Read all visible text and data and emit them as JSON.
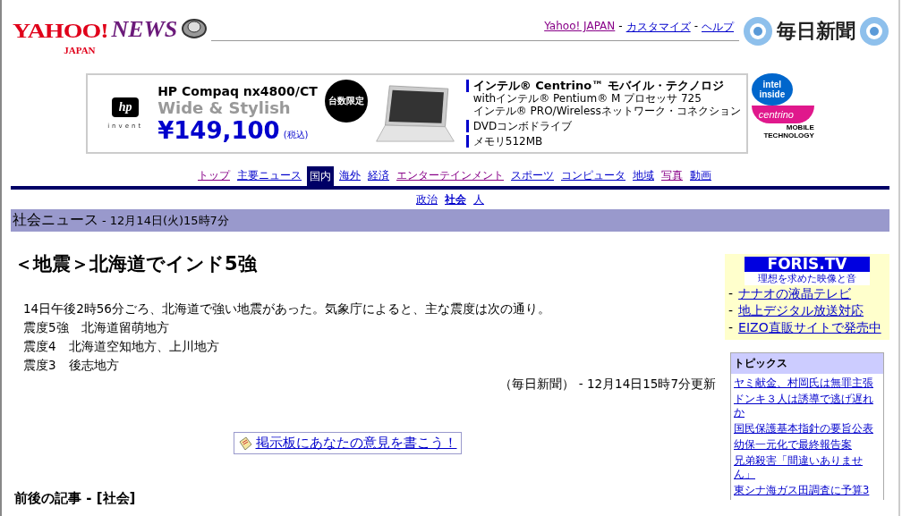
{
  "header": {
    "logo": {
      "main": "YAHOO!",
      "sub": "JAPAN",
      "news": "NEWS"
    },
    "links": [
      {
        "label": "Yahoo! JAPAN",
        "visited": true
      },
      {
        "label": "カスタマイズ",
        "visited": false
      },
      {
        "label": "ヘルプ",
        "visited": false
      }
    ],
    "separator": "-",
    "partner": "毎日新聞"
  },
  "ad": {
    "hp_logo": "hp",
    "hp_tagline": "invent",
    "title": "HP Compaq nx4800/CT",
    "subtitle": "Wide & Stylish",
    "price": "¥149,100",
    "tax": "(税込)",
    "badge": "台数限定",
    "features": [
      {
        "text": "インテル® Centrino™ モバイル・テクノロジ",
        "kind": "heading"
      },
      {
        "text": "withインテル® Pentium® M プロセッサ 725",
        "kind": "line"
      },
      {
        "text": "インテル® PRO/Wirelessネットワーク・コネクション",
        "kind": "line"
      },
      {
        "text": "DVDコンボドライブ",
        "kind": "heading-small"
      },
      {
        "text": "メモリ512MB",
        "kind": "heading-small"
      }
    ],
    "centrino": {
      "inside": "intel inside",
      "name": "centrino",
      "caption": "MOBILE TECHNOLOGY"
    }
  },
  "nav": [
    {
      "label": "トップ",
      "selected": false,
      "visited": true
    },
    {
      "label": "主要ニュース",
      "selected": false,
      "visited": false
    },
    {
      "label": "国内",
      "selected": true,
      "visited": false
    },
    {
      "label": "海外",
      "selected": false,
      "visited": false
    },
    {
      "label": "経済",
      "selected": false,
      "visited": false
    },
    {
      "label": "エンターテインメント",
      "selected": false,
      "visited": true
    },
    {
      "label": "スポーツ",
      "selected": false,
      "visited": false
    },
    {
      "label": "コンピュータ",
      "selected": false,
      "visited": false
    },
    {
      "label": "地域",
      "selected": false,
      "visited": false
    },
    {
      "label": "写真",
      "selected": false,
      "visited": true
    },
    {
      "label": "動画",
      "selected": false,
      "visited": false
    }
  ],
  "subnav": [
    {
      "label": "政治",
      "selected": false
    },
    {
      "label": "社会",
      "selected": true
    },
    {
      "label": "人",
      "selected": false
    }
  ],
  "section": {
    "title": "社会ニュース",
    "date": "- 12月14日(火)15時7分"
  },
  "article": {
    "headline": "＜地震＞北海道でインド5強",
    "lines": [
      "14日午後2時56分ごろ、北海道で強い地震があった。気象庁によると、主な震度は次の通り。",
      "震度5強　北海道留萌地方",
      "震度4　北海道空知地方、上川地方",
      "震度3　後志地方"
    ],
    "source": "（毎日新聞） - 12月14日15時7分更新",
    "board_link": "掲示板にあなたの意見を書こう！",
    "related_heading": "前後の記事 - [社会]"
  },
  "sidebar": {
    "promo": {
      "brand": "FORIS.TV",
      "tagline": "理想を求めた映像と音",
      "bullet": "-",
      "links": [
        "ナナオの液晶テレビ",
        "地上デジタル放送対応",
        "EIZO直販サイトで発売中"
      ]
    },
    "topics": {
      "title": "トピックス",
      "links": [
        "ヤミ献金、村岡氏は無罪主張",
        "ドンキ３人は誘導で逃げ遅れか",
        "国民保護基本指針の要旨公表",
        "幼保一元化で最終報告案",
        "兄弟殺害「間違いありません」",
        "東シナ海ガス田調査に予算3"
      ]
    }
  }
}
